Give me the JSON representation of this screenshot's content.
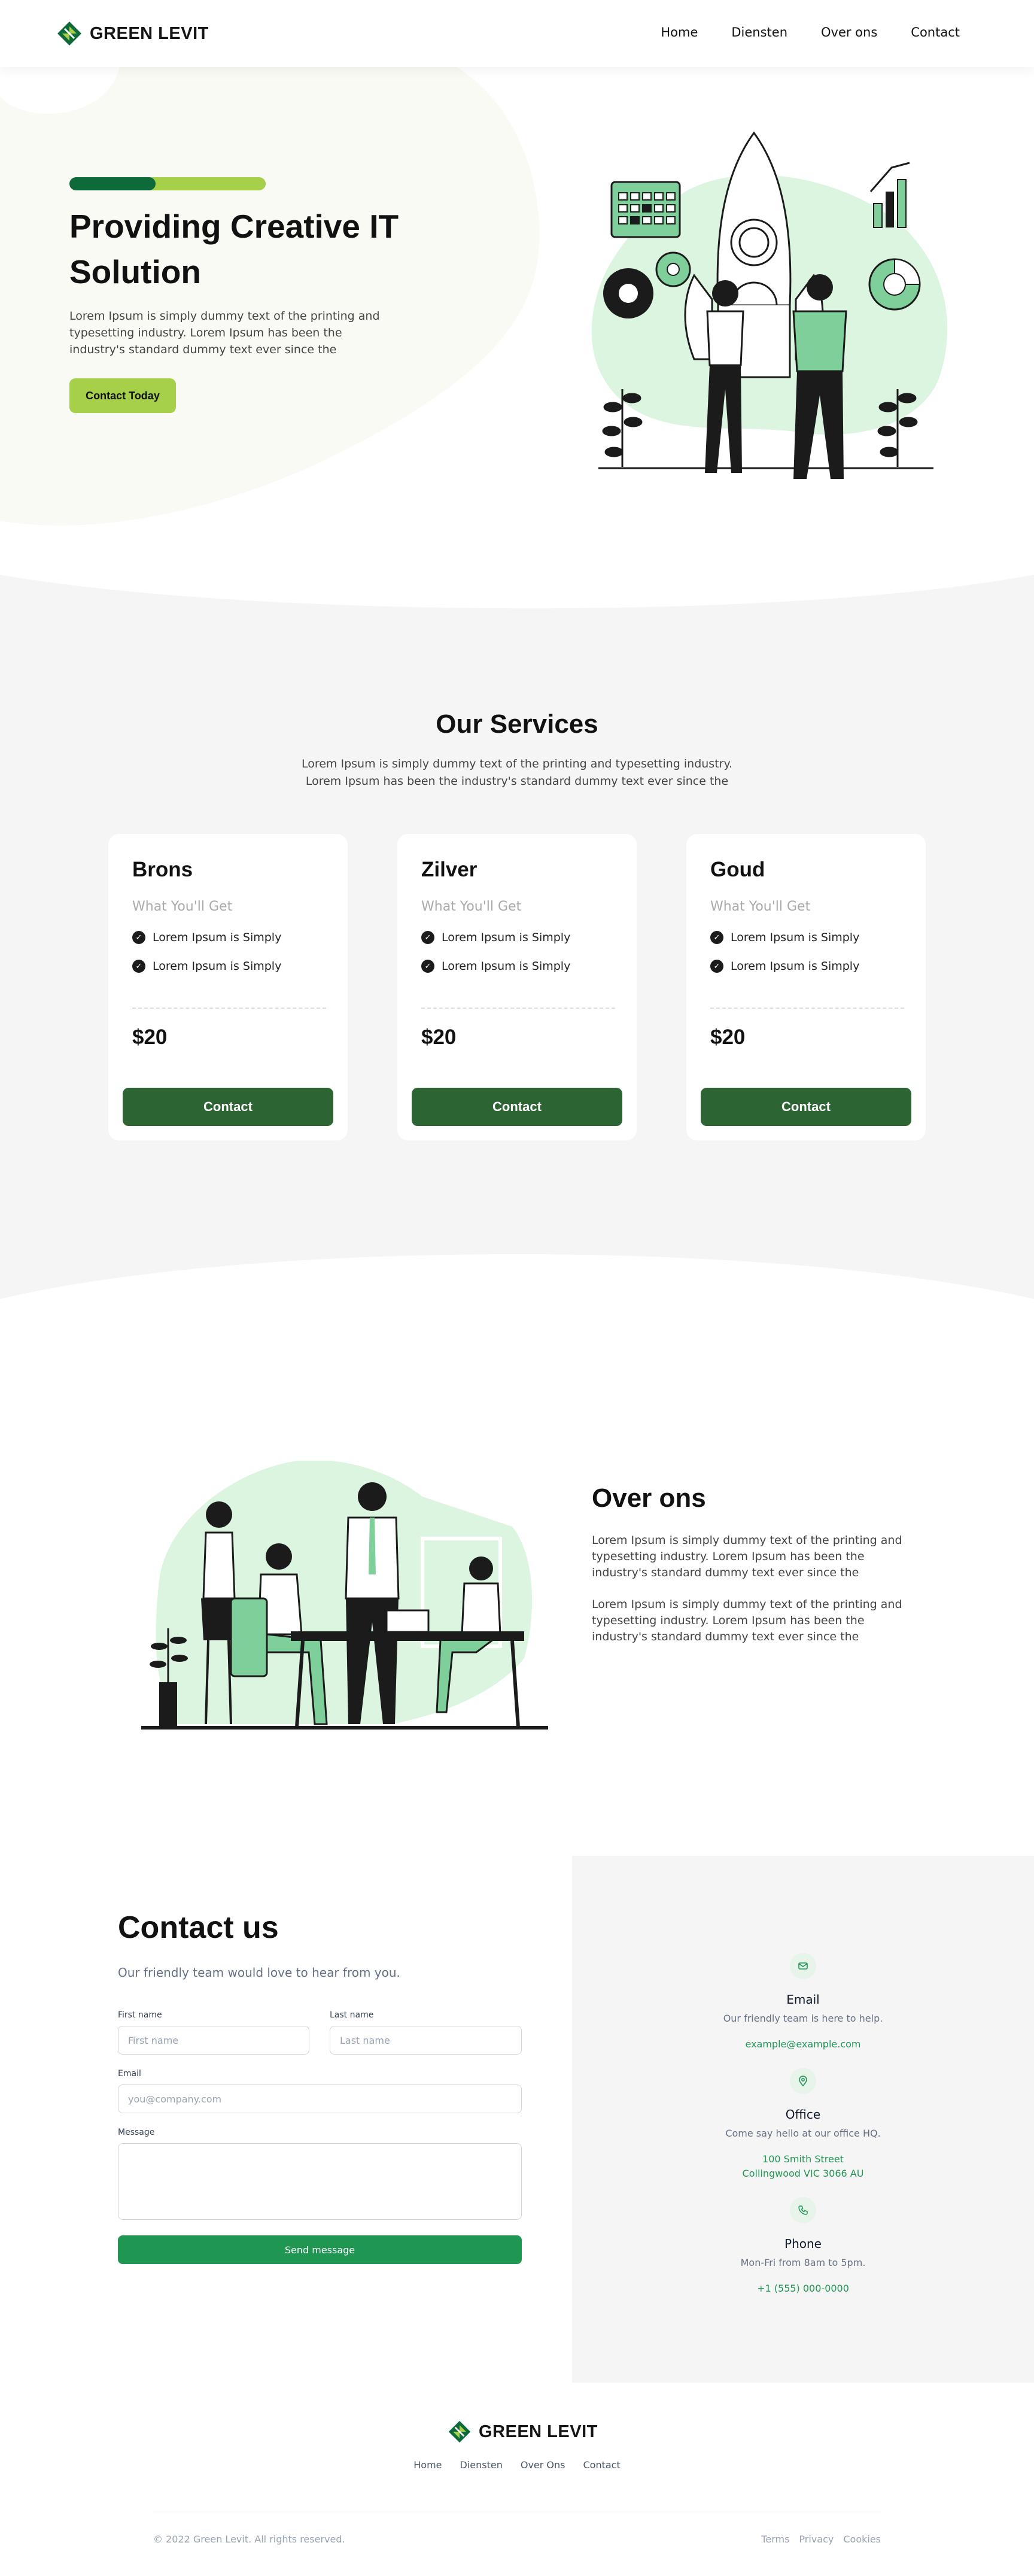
{
  "nav": {
    "logo_text": "GREEN LEVIT",
    "links": [
      "Home",
      "Diensten",
      "Over ons",
      "Contact"
    ]
  },
  "hero": {
    "title": "Providing Creative IT Solution",
    "text": "Lorem Ipsum is simply dummy text of the printing and typesetting industry. Lorem Ipsum has been the industry's standard dummy text ever since the",
    "cta": "Contact Today"
  },
  "services": {
    "title": "Our Services",
    "text": "Lorem Ipsum is simply dummy text of the printing and typesetting industry. Lorem Ipsum has been the industry's standard dummy text ever since the",
    "cards": [
      {
        "name": "Brons",
        "subtitle": "What You'll Get",
        "features": [
          "Lorem Ipsum is Simply",
          "Lorem Ipsum is Simply"
        ],
        "price": "$20",
        "button": "Contact"
      },
      {
        "name": "Zilver",
        "subtitle": "What You'll Get",
        "features": [
          "Lorem Ipsum is Simply",
          "Lorem Ipsum is Simply"
        ],
        "price": "$20",
        "button": "Contact"
      },
      {
        "name": "Goud",
        "subtitle": "What You'll Get",
        "features": [
          "Lorem Ipsum is Simply",
          "Lorem Ipsum is Simply"
        ],
        "price": "$20",
        "button": "Contact"
      }
    ]
  },
  "about": {
    "title": "Over ons",
    "paragraphs": [
      "Lorem Ipsum is simply dummy text of the printing and typesetting industry. Lorem Ipsum has been the industry's standard dummy text ever since the",
      "Lorem Ipsum is simply dummy text of the printing and typesetting industry. Lorem Ipsum has been the industry's standard dummy text ever since the"
    ]
  },
  "contact": {
    "title": "Contact us",
    "subtitle": "Our friendly team would love to hear from you.",
    "form": {
      "first_name_label": "First name",
      "first_name_placeholder": "First name",
      "last_name_label": "Last name",
      "last_name_placeholder": "Last name",
      "email_label": "Email",
      "email_placeholder": "you@company.com",
      "message_label": "Message",
      "submit": "Send message"
    },
    "info": [
      {
        "icon": "mail-icon",
        "title": "Email",
        "desc": "Our friendly team is here to help.",
        "value": "example@example.com"
      },
      {
        "icon": "map-pin-icon",
        "title": "Office",
        "desc": "Come say hello at our office HQ.",
        "value_lines": [
          "100 Smith Street",
          "Collingwood VIC 3066 AU"
        ]
      },
      {
        "icon": "phone-icon",
        "title": "Phone",
        "desc": "Mon-Fri from 8am to 5pm.",
        "value": "+1 (555) 000-0000"
      }
    ]
  },
  "footer": {
    "logo_text": "GREEN LEVIT",
    "links": [
      "Home",
      "Diensten",
      "Over Ons",
      "Contact"
    ],
    "copyright": "© 2022 Green Levit. All rights reserved.",
    "legal": [
      "Terms",
      "Privacy",
      "Cookies"
    ]
  },
  "colors": {
    "brand_dark": "#0f6a3a",
    "brand_lime": "#a6cf4a",
    "button_green": "#2d6434",
    "accent_green": "#1f9652",
    "illustration_mint": "#dcf5e1"
  }
}
